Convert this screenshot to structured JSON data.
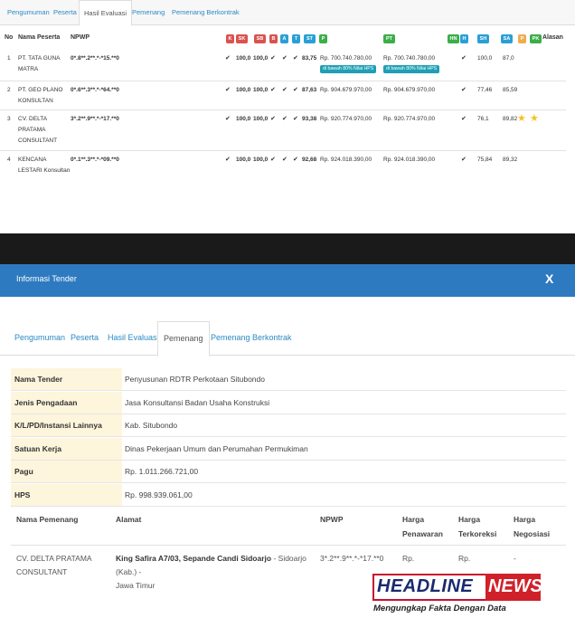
{
  "top_tabs": [
    "Pengumuman",
    "Peserta",
    "Hasil Evaluasi",
    "Pemenang",
    "Pemenang Berkontrak"
  ],
  "eval_headers": {
    "no": "No",
    "nama": "Nama Peserta",
    "npwp": "NPWP",
    "alasan": "Alasan"
  },
  "badges": [
    {
      "label": "K",
      "color": "#d9534f"
    },
    {
      "label": "SK",
      "color": "#d9534f"
    },
    {
      "label": "SB",
      "color": "#d9534f"
    },
    {
      "label": "B",
      "color": "#d9534f"
    },
    {
      "label": "A",
      "color": "#2a9fd6"
    },
    {
      "label": "T",
      "color": "#2a9fd6"
    },
    {
      "label": "ST",
      "color": "#2a9fd6"
    },
    {
      "label": "P",
      "color": "#3bae4a"
    },
    {
      "label": "PT",
      "color": "#3bae4a"
    },
    {
      "label": "HN",
      "color": "#3bae4a"
    },
    {
      "label": "H",
      "color": "#2a9fd6"
    },
    {
      "label": "SH",
      "color": "#2a9fd6"
    },
    {
      "label": "SA",
      "color": "#2a9fd6"
    },
    {
      "label": "P",
      "color": "#f0ad4e"
    },
    {
      "label": "PK",
      "color": "#3bae4a"
    }
  ],
  "rows": [
    {
      "no": "1",
      "nama": [
        "PT. TATA GUNA",
        "MATRA"
      ],
      "npwp": "0*.8**.2**.*-*15.**0",
      "v1": "100,0",
      "v2": "100,0",
      "skor": "83,75",
      "penawaran": "Rp. 700.740.780,00",
      "terkoreksi": "Rp. 700.740.780,00",
      "tag": "di bawah 80% Nilai HPS",
      "sh": "100,0",
      "sa": "87,0",
      "stars": 0
    },
    {
      "no": "2",
      "nama": [
        "PT. GEO PLANO",
        "KONSULTAN"
      ],
      "npwp": "0*.6**.3**.*-*64.**0",
      "v1": "100,0",
      "v2": "100,0",
      "skor": "87,63",
      "penawaran": "Rp. 904.679.970,00",
      "terkoreksi": "Rp. 904.679.970,00",
      "tag": "",
      "sh": "77,46",
      "sa": "85,59",
      "stars": 0
    },
    {
      "no": "3",
      "nama": [
        "CV. DELTA",
        "PRATAMA",
        "CONSULTANT"
      ],
      "npwp": "3*.2**.9**.*-*17.**0",
      "v1": "100,0",
      "v2": "100,0",
      "skor": "93,38",
      "penawaran": "Rp. 920.774.970,00",
      "terkoreksi": "Rp. 920.774.970,00",
      "tag": "",
      "sh": "76,1",
      "sa": "89,82",
      "stars": 2
    },
    {
      "no": "4",
      "nama": [
        "KENCANA",
        "LESTARI Konsultan"
      ],
      "npwp": "0*.1**.3**.*-*09.**0",
      "v1": "100,0",
      "v2": "100,0",
      "skor": "92,68",
      "penawaran": "Rp. 924.018.390,00",
      "terkoreksi": "Rp. 924.018.390,00",
      "tag": "",
      "sh": "75,84",
      "sa": "89,32",
      "stars": 0
    }
  ],
  "check": "✔",
  "modal": {
    "title": "Informasi Tender",
    "close": "X",
    "tabs": [
      "Pengumuman",
      "Peserta",
      "Hasil Evaluasi",
      "Pemenang",
      "Pemenang Berkontrak"
    ],
    "fields": [
      {
        "label": "Nama Tender",
        "value": "Penyusunan RDTR Perkotaan Situbondo"
      },
      {
        "label": "Jenis Pengadaan",
        "value": "Jasa Konsultansi Badan Usaha Konstruksi"
      },
      {
        "label": "K/L/PD/Instansi Lainnya",
        "value": "Kab. Situbondo"
      },
      {
        "label": "Satuan Kerja",
        "value": "Dinas Pekerjaan Umum dan Perumahan Permukiman"
      },
      {
        "label": "Pagu",
        "value": "Rp. 1.011.266.721,00"
      },
      {
        "label": "HPS",
        "value": "Rp. 998.939.061,00"
      }
    ],
    "winner_headers": {
      "nama": "Nama Pemenang",
      "alamat": "Alamat",
      "npwp": "NPWP",
      "h1": "Harga",
      "h1b": "Penawaran",
      "h2": "Harga",
      "h2b": "Terkoreksi",
      "h3": "Harga",
      "h3b": "Negosiasi"
    },
    "winner": {
      "nama1": "CV. DELTA PRATAMA",
      "nama2": "CONSULTANT",
      "alamat_bold": "King Safira A7/03, Sepande Candi Sidoarjo",
      "alamat_rest": " - Sidoarjo (Kab.) -",
      "alamat2": "Jawa Timur",
      "npwp": "3*.2**.9**.*-*17.**0",
      "penawaran": "Rp.",
      "terkoreksi": "Rp.",
      "negosiasi": "-"
    }
  },
  "logo": {
    "part1": "HEADLINE",
    "part2": "NEWS",
    "tagline": "Mengungkap Fakta Dengan Data"
  }
}
